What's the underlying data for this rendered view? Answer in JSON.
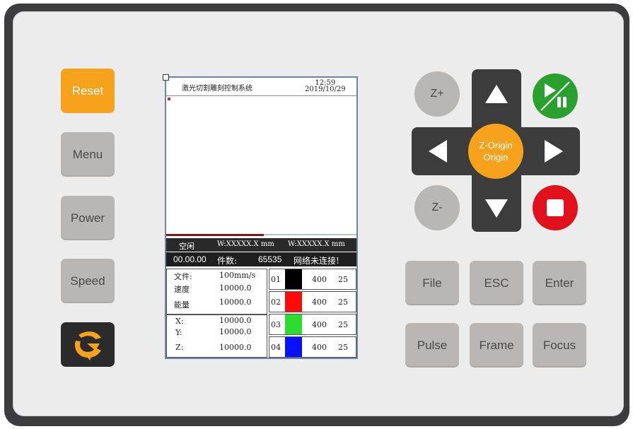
{
  "left_buttons": {
    "reset": "Reset",
    "menu": "Menu",
    "power": "Power",
    "speed": "Speed"
  },
  "logo_icon": "c-swirl-logo-icon",
  "screen": {
    "title": "激光切割雕刻控制系统",
    "time": "12:59",
    "date": "2019/10/29",
    "status_state": "空闲",
    "w_left": "W:XXXXX.X mm",
    "w_right": "W:XXXXX.X mm",
    "runtime": "00.00.00",
    "pieces_label": "件数:",
    "pieces_value": "65535",
    "network": "网络未连接!",
    "params": {
      "file_label": "文件:",
      "file_value": "100mm/s",
      "speed_label": "速度",
      "speed_value": "10000.0",
      "power_label": "能量",
      "power_value": "10000.0",
      "x_label": "X:",
      "x_value": "10000.0",
      "y_label": "Y:",
      "y_value": "10000.0",
      "z_label": "Z:",
      "z_value": "10000.0"
    },
    "layers": [
      {
        "num": "01",
        "color": "#000000",
        "speed": "400",
        "power": "25"
      },
      {
        "num": "02",
        "color": "#ff0a0a",
        "speed": "400",
        "power": "25"
      },
      {
        "num": "03",
        "color": "#2edc2e",
        "speed": "400",
        "power": "25"
      },
      {
        "num": "04",
        "color": "#0a10ff",
        "speed": "400",
        "power": "25"
      }
    ]
  },
  "nav": {
    "z_plus": "Z+",
    "z_minus": "Z-",
    "center_line1": "Z-Origin",
    "center_line2": "Origin",
    "up_icon": "arrow-up-icon",
    "down_icon": "arrow-down-icon",
    "left_icon": "arrow-left-icon",
    "right_icon": "arrow-right-icon",
    "start_pause_icon": "play-pause-icon",
    "stop_icon": "stop-icon"
  },
  "function_buttons": {
    "file": "File",
    "esc": "ESC",
    "enter": "Enter",
    "pulse": "Pulse",
    "frame": "Frame",
    "focus": "Focus"
  },
  "colors": {
    "accent_orange": "#f6a21c",
    "button_grey": "#b9b7b5",
    "start_green": "#2aa12e",
    "stop_red": "#e0111b",
    "bezel": "#3c3c3e"
  }
}
